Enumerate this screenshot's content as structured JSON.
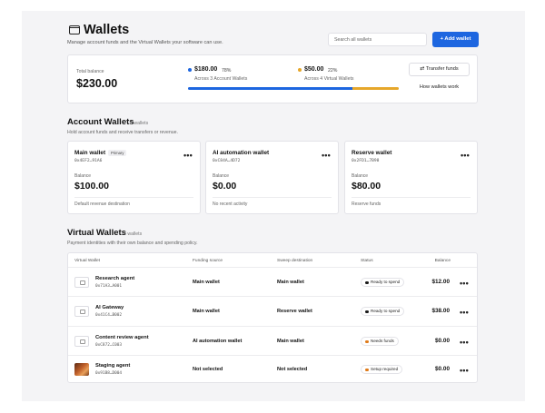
{
  "header": {
    "title": "Wallets",
    "subtitle": "Manage account funds and the Virtual Wallets your software can use.",
    "search_placeholder": "Search all wallets",
    "add_button": "+ Add wallet"
  },
  "summary": {
    "total_label": "Total balance",
    "total_value": "$230.00",
    "account": {
      "amount": "$180.00",
      "percent": "78%",
      "caption": "Across 3 Account Wallets",
      "color": "#1d66e0"
    },
    "virtual": {
      "amount": "$50.00",
      "percent": "22%",
      "caption": "Across 4 Virtual Wallets",
      "color": "#e6a72a"
    },
    "bar_fractions": {
      "account": 0.78,
      "virtual": 0.22
    },
    "transfer_button": "Transfer funds",
    "how_button": "How wallets work"
  },
  "account_section": {
    "title": "Account Wallets",
    "count": "3 wallets",
    "subtitle": "Hold account funds and receive transfers or revenue.",
    "wallets": [
      {
        "name": "Main wallet",
        "badge": "Primary",
        "address": "0x4EF2…91A6",
        "balance_label": "Balance",
        "balance": "$100.00",
        "footer": "Default revenue destination"
      },
      {
        "name": "AI automation wallet",
        "badge": "",
        "address": "0xC84A…4D72",
        "balance_label": "Balance",
        "balance": "$0.00",
        "footer": "No recent activity"
      },
      {
        "name": "Reserve wallet",
        "badge": "",
        "address": "0x2FD1…7B98",
        "balance_label": "Balance",
        "balance": "$80.00",
        "footer": "Reserve funds"
      }
    ]
  },
  "virtual_section": {
    "title": "Virtual Wallets",
    "count": "4 wallets",
    "subtitle": "Payment identities with their own balance and spending policy.",
    "columns": [
      "Virtual Wallet",
      "Funding source",
      "Sweep destination",
      "Status",
      "Balance"
    ],
    "rows": [
      {
        "name": "Research agent",
        "address": "0x71A3…A001",
        "funding": "Main wallet",
        "sweep": "Main wallet",
        "status": "Ready to spend",
        "status_color": "#1a1a1a",
        "balance": "$12.00",
        "thumb": "icon"
      },
      {
        "name": "AI Gateway",
        "address": "0x41C4…B002",
        "funding": "Main wallet",
        "sweep": "Reserve wallet",
        "status": "Ready to spend",
        "status_color": "#1a1a1a",
        "balance": "$38.00",
        "thumb": "icon"
      },
      {
        "name": "Content review agent",
        "address": "0xC872…C003",
        "funding": "AI automation wallet",
        "sweep": "Main wallet",
        "status": "Needs funds",
        "status_color": "#e07b1a",
        "balance": "$0.00",
        "thumb": "icon"
      },
      {
        "name": "Staging agent",
        "address": "0x91B8…D004",
        "funding": "Not selected",
        "sweep": "Not selected",
        "status": "Setup required",
        "status_color": "#e07b1a",
        "balance": "$0.00",
        "thumb": "image"
      }
    ]
  },
  "icons": {
    "wallet": "wallet-icon",
    "more": "more-horizontal-icon",
    "transfer": "transfer-arrows-icon",
    "wallet_thumb": "wallet-thumbnail-icon"
  }
}
